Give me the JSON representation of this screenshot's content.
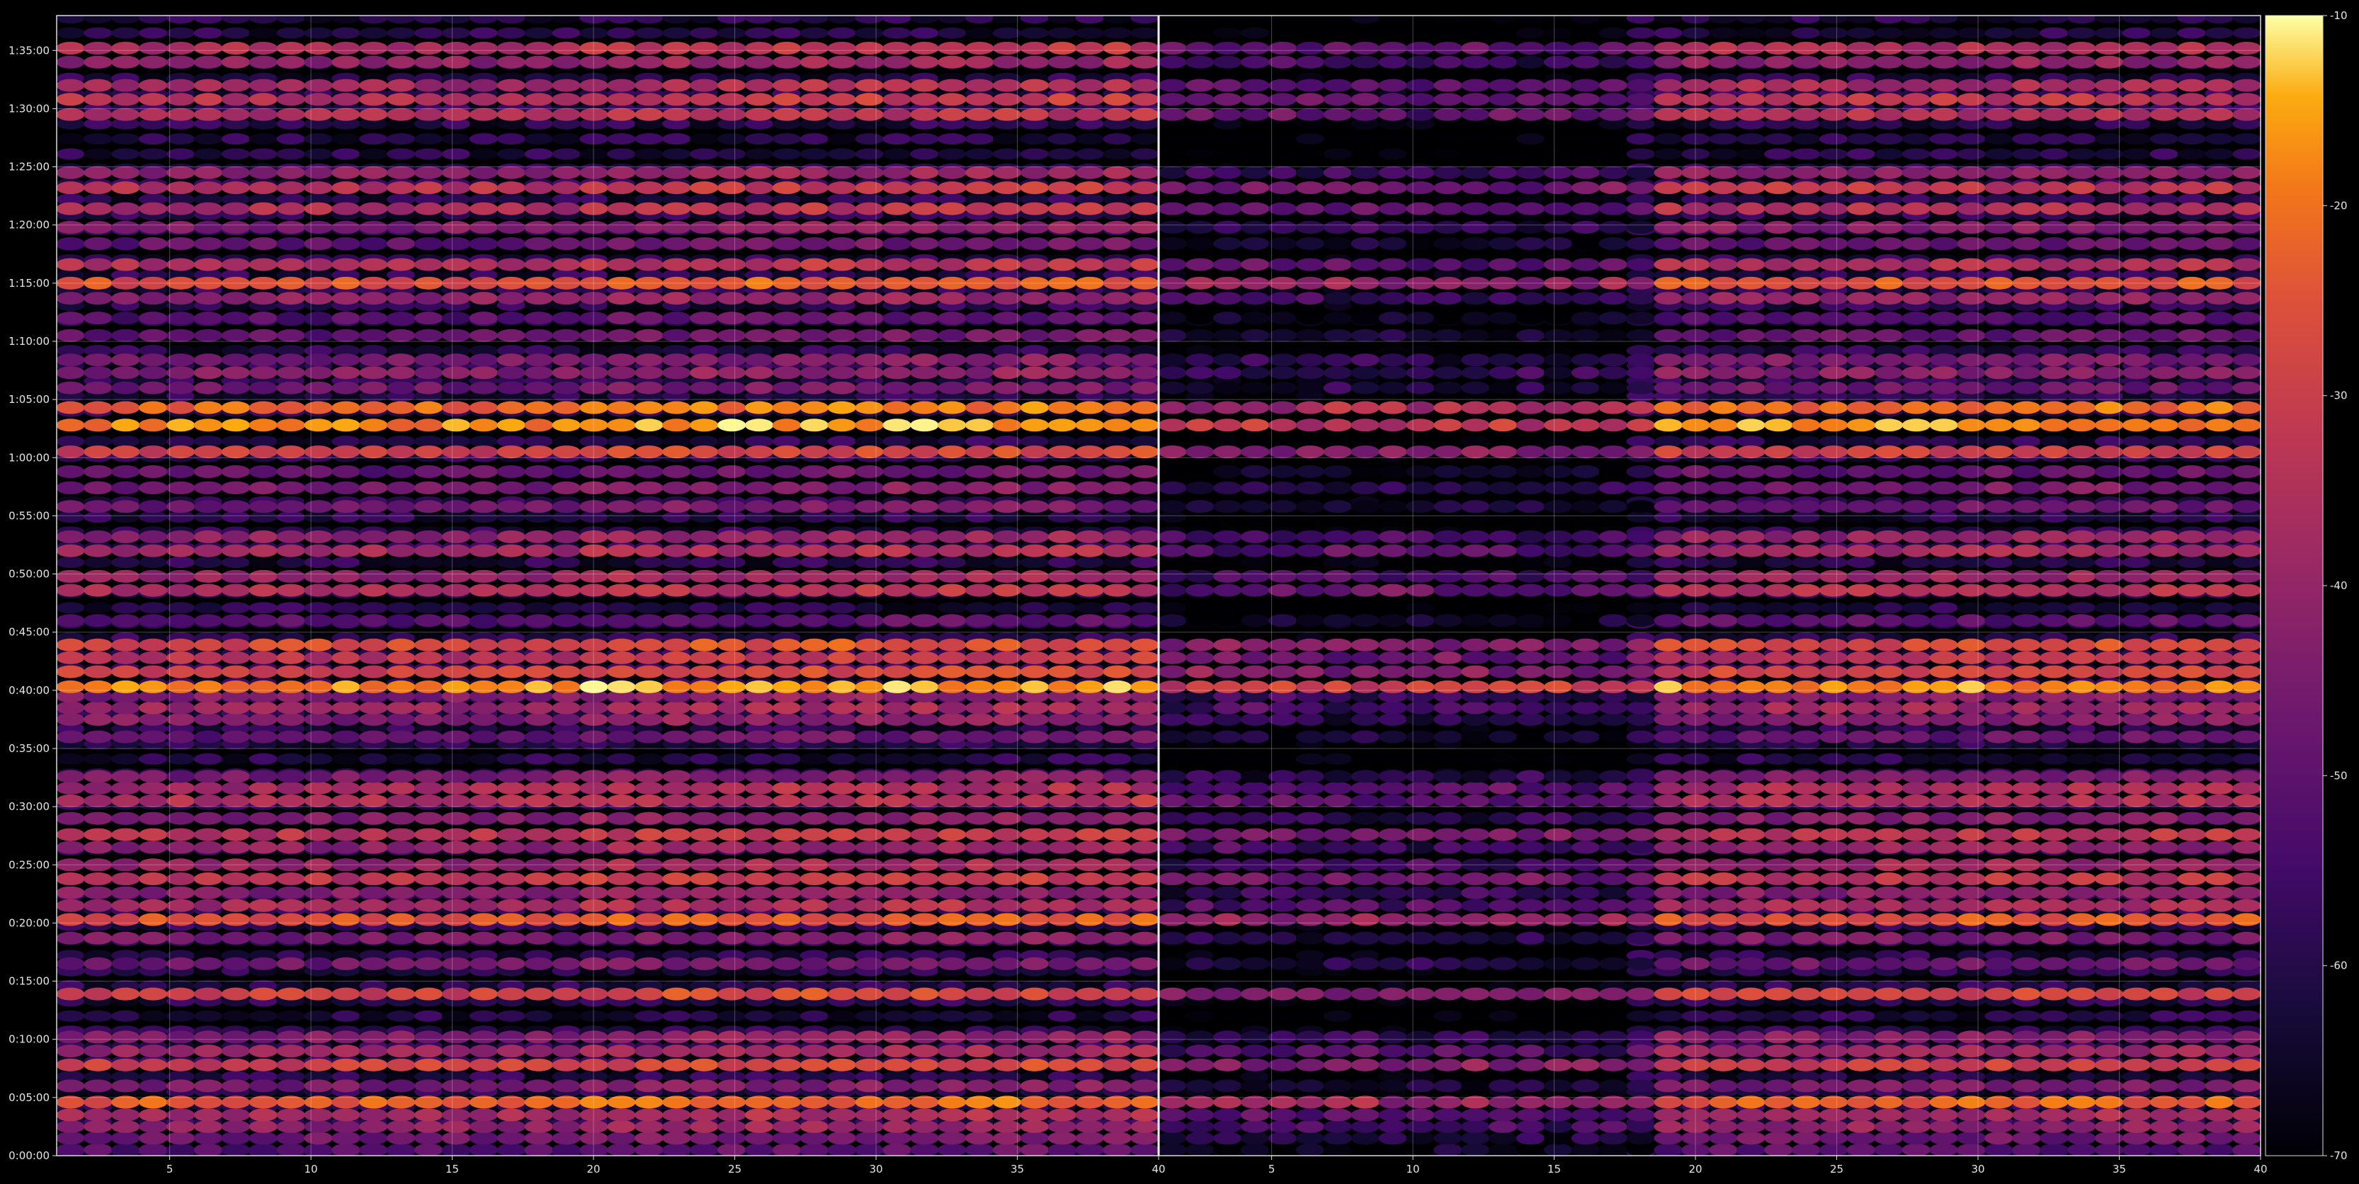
{
  "chart_data": {
    "type": "heatmap",
    "title": "",
    "xlabel": "",
    "ylabel": "",
    "colormap": "inferno",
    "grid": true,
    "panels": [
      {
        "name": "",
        "xlim": [
          1,
          40
        ],
        "x_ticks": [
          5,
          10,
          15,
          20,
          25,
          30,
          35,
          40
        ],
        "x_tick_labels": [
          "5",
          "10",
          "15",
          "20",
          "25",
          "30",
          "35",
          "40"
        ]
      },
      {
        "name": "",
        "xlim": [
          1,
          40
        ],
        "x_ticks": [
          5,
          10,
          15,
          20,
          25,
          30,
          35,
          40
        ],
        "x_tick_labels": [
          "5",
          "10",
          "15",
          "20",
          "25",
          "30",
          "35",
          "40"
        ]
      }
    ],
    "y_unit": "minutes",
    "ylim": [
      0,
      98
    ],
    "y_ticks": [
      0,
      5,
      10,
      15,
      20,
      25,
      30,
      35,
      40,
      45,
      50,
      55,
      60,
      65,
      70,
      75,
      80,
      85,
      90,
      95
    ],
    "y_tick_labels": [
      "0:00:00",
      "0:05:00",
      "0:10:00",
      "0:15:00",
      "0:20:00",
      "0:25:00",
      "0:30:00",
      "0:35:00",
      "0:40:00",
      "0:45:00",
      "0:50:00",
      "0:55:00",
      "1:00:00",
      "1:05:00",
      "1:10:00",
      "1:15:00",
      "1:20:00",
      "1:25:00",
      "1:30:00",
      "1:35:00"
    ],
    "colorbar": {
      "range": [
        -70,
        -10
      ],
      "ticks": [
        -70,
        -60,
        -50,
        -40,
        -30,
        -20,
        -10
      ],
      "tick_labels": [
        "-70",
        "-60",
        "-50",
        "-40",
        "-30",
        "-20",
        "-10"
      ]
    },
    "strong_rows_minutes": [
      {
        "t": 0.5,
        "level": -52
      },
      {
        "t": 1.5,
        "level": -48
      },
      {
        "t": 2.5,
        "level": -42
      },
      {
        "t": 3.5,
        "level": -38
      },
      {
        "t": 4.6,
        "level": -24
      },
      {
        "t": 6.0,
        "level": -46
      },
      {
        "t": 7.8,
        "level": -30
      },
      {
        "t": 9.0,
        "level": -40
      },
      {
        "t": 10.2,
        "level": -44
      },
      {
        "t": 13.9,
        "level": -30
      },
      {
        "t": 16.5,
        "level": -48
      },
      {
        "t": 18.7,
        "level": -46
      },
      {
        "t": 20.3,
        "level": -26
      },
      {
        "t": 21.5,
        "level": -38
      },
      {
        "t": 22.6,
        "level": -44
      },
      {
        "t": 23.8,
        "level": -34
      },
      {
        "t": 25.0,
        "level": -40
      },
      {
        "t": 26.5,
        "level": -42
      },
      {
        "t": 27.6,
        "level": -34
      },
      {
        "t": 29.0,
        "level": -44
      },
      {
        "t": 30.5,
        "level": -36
      },
      {
        "t": 31.6,
        "level": -38
      },
      {
        "t": 32.6,
        "level": -46
      },
      {
        "t": 36.0,
        "level": -50
      },
      {
        "t": 37.5,
        "level": -44
      },
      {
        "t": 38.5,
        "level": -40
      },
      {
        "t": 39.5,
        "level": -44
      },
      {
        "t": 40.3,
        "level": -18
      },
      {
        "t": 41.6,
        "level": -30
      },
      {
        "t": 42.8,
        "level": -34
      },
      {
        "t": 43.9,
        "level": -28
      },
      {
        "t": 46.0,
        "level": -52
      },
      {
        "t": 48.6,
        "level": -36
      },
      {
        "t": 49.8,
        "level": -40
      },
      {
        "t": 52.0,
        "level": -38
      },
      {
        "t": 53.2,
        "level": -42
      },
      {
        "t": 55.8,
        "level": -48
      },
      {
        "t": 57.4,
        "level": -46
      },
      {
        "t": 58.8,
        "level": -50
      },
      {
        "t": 60.5,
        "level": -30
      },
      {
        "t": 62.8,
        "level": -18
      },
      {
        "t": 64.3,
        "level": -22
      },
      {
        "t": 66.0,
        "level": -48
      },
      {
        "t": 67.3,
        "level": -44
      },
      {
        "t": 68.4,
        "level": -46
      },
      {
        "t": 70.5,
        "level": -50
      },
      {
        "t": 72.0,
        "level": -52
      },
      {
        "t": 73.7,
        "level": -42
      },
      {
        "t": 75.0,
        "level": -26
      },
      {
        "t": 76.6,
        "level": -36
      },
      {
        "t": 78.4,
        "level": -50
      },
      {
        "t": 79.8,
        "level": -44
      },
      {
        "t": 81.4,
        "level": -36
      },
      {
        "t": 83.2,
        "level": -34
      },
      {
        "t": 84.5,
        "level": -42
      },
      {
        "t": 89.5,
        "level": -36
      },
      {
        "t": 90.8,
        "level": -34
      },
      {
        "t": 92.0,
        "level": -38
      },
      {
        "t": 94.0,
        "level": -42
      },
      {
        "t": 95.2,
        "level": -36
      }
    ]
  }
}
